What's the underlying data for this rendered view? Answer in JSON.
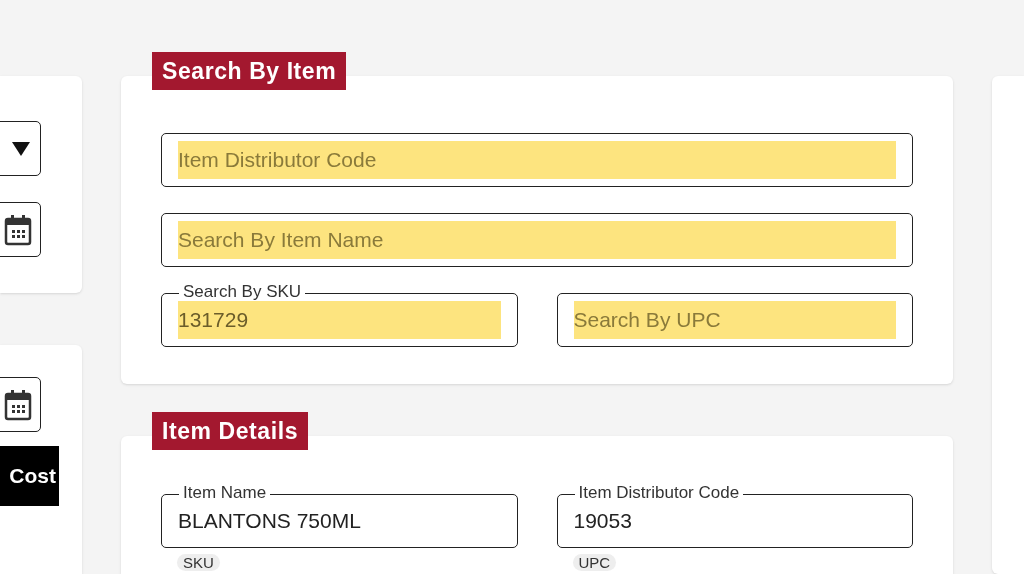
{
  "left_panel": {
    "cost_button": "Cost"
  },
  "search_section": {
    "title": "Search By Item",
    "fields": [
      {
        "placeholder": "Item Distributor Code",
        "highlighted": true
      },
      {
        "placeholder": "Search By Item Name",
        "highlighted": true
      }
    ],
    "row_fields": [
      {
        "label": "Search By SKU",
        "value": "131729",
        "highlighted": true
      },
      {
        "placeholder": "Search By UPC",
        "highlighted": true
      }
    ]
  },
  "details_section": {
    "title": "Item Details",
    "fields": [
      {
        "label": "Item Name",
        "value": "BLANTONS 750ML"
      },
      {
        "label": "Item Distributor Code",
        "value": "19053"
      }
    ],
    "next_labels": [
      "SKU",
      "UPC"
    ]
  }
}
